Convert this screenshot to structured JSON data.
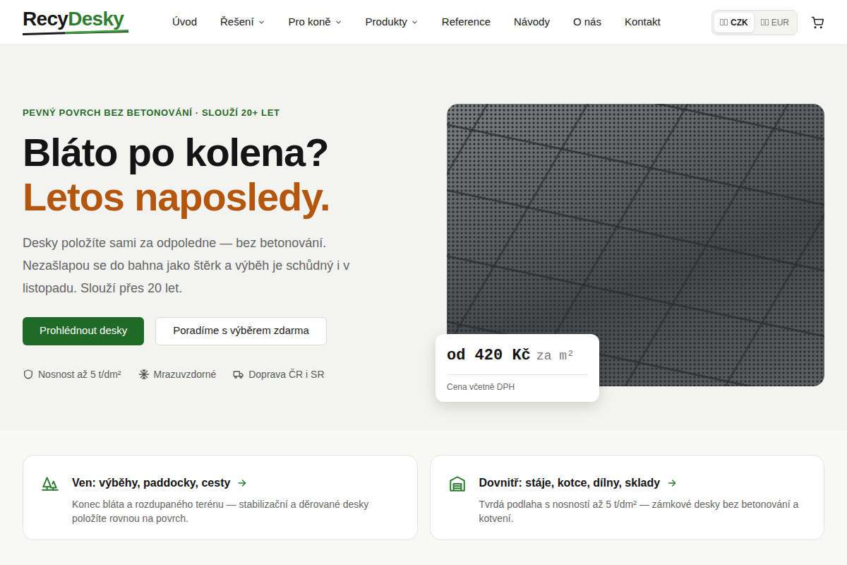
{
  "logo": {
    "part1": "Recy",
    "part2": "Desky"
  },
  "nav": [
    {
      "label": "Úvod",
      "dropdown": false
    },
    {
      "label": "Řešení",
      "dropdown": true
    },
    {
      "label": "Pro koně",
      "dropdown": true
    },
    {
      "label": "Produkty",
      "dropdown": true
    },
    {
      "label": "Reference",
      "dropdown": false
    },
    {
      "label": "Návody",
      "dropdown": false
    },
    {
      "label": "O nás",
      "dropdown": false
    },
    {
      "label": "Kontakt",
      "dropdown": false
    }
  ],
  "currency": [
    {
      "label": "CZK",
      "selected": true
    },
    {
      "label": "EUR",
      "selected": false
    }
  ],
  "hero": {
    "eyebrow": "PEVNÝ POVRCH BEZ BETONOVÁNÍ · SLOUŽÍ 20+ LET",
    "title_line1": "Bláto po kolena?",
    "title_line2": "Letos naposledy.",
    "description": "Desky položíte sami za odpoledne — bez betonování. Nezašlapou se do bahna jako štěrk a výběh je schůdný i v listopadu. Slouží přes 20 let.",
    "primary_button": "Prohlédnout desky",
    "secondary_button": "Poradíme s výběrem zdarma",
    "features": [
      "Nosnost až 5 t/dm²",
      "Mrazuvzdorné",
      "Doprava ČR i SR"
    ]
  },
  "price_card": {
    "amount": "od 420 Kč",
    "unit": "za m²",
    "note": "Cena včetně DPH"
  },
  "categories": [
    {
      "title": "Ven: výběhy, paddocky, cesty",
      "description": "Konec bláta a rozdupaného terénu — stabilizační a děrované desky položíte rovnou na povrch."
    },
    {
      "title": "Dovnitř: stáje, kotce, dílny, sklady",
      "description": "Tvrdá podlaha s nosností až 5 t/dm² — zámkové desky bez betonování a kotvení."
    }
  ]
}
